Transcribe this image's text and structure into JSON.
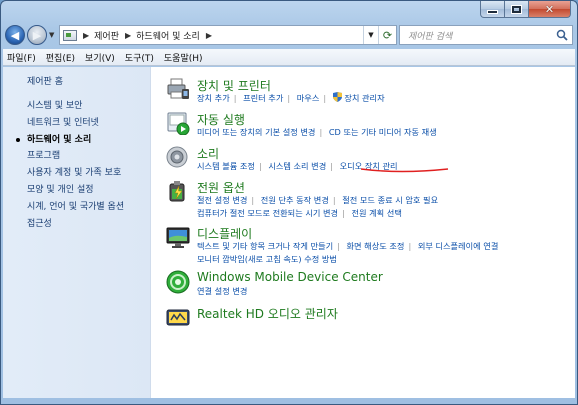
{
  "address": {
    "crumbs": [
      "제어판",
      "하드웨어 및 소리"
    ]
  },
  "search": {
    "placeholder": "제어판 검색"
  },
  "menu": [
    "파일(F)",
    "편집(E)",
    "보기(V)",
    "도구(T)",
    "도움말(H)"
  ],
  "sidebar": {
    "home": "제어판 홈",
    "items": [
      {
        "label": "시스템 및 보안",
        "current": false
      },
      {
        "label": "네트워크 및 인터넷",
        "current": false
      },
      {
        "label": "하드웨어 및 소리",
        "current": true
      },
      {
        "label": "프로그램",
        "current": false
      },
      {
        "label": "사용자 계정 및 가족 보호",
        "current": false
      },
      {
        "label": "모양 및 개인 설정",
        "current": false
      },
      {
        "label": "시계, 언어 및 국가별 옵션",
        "current": false
      },
      {
        "label": "접근성",
        "current": false
      }
    ]
  },
  "categories": [
    {
      "title": "장치 및 프린터",
      "icon": "printer-icon",
      "links": [
        [
          "장치 추가",
          "프린터 추가",
          "마우스",
          "장치 관리자"
        ]
      ]
    },
    {
      "title": "자동 실행",
      "icon": "autoplay-icon",
      "links": [
        [
          "미디어 또는 장치의 기본 설정 변경",
          "CD 또는 기타 미디어 자동 재생"
        ]
      ]
    },
    {
      "title": "소리",
      "icon": "speaker-icon",
      "links": [
        [
          "시스템 볼륨 조정",
          "시스템 소리 변경",
          "오디오 장치 관리"
        ]
      ]
    },
    {
      "title": "전원 옵션",
      "icon": "power-icon",
      "links": [
        [
          "절전 설정 변경",
          "전원 단추 동작 변경",
          "절전 모드 종료 시 암호 필요"
        ],
        [
          "컴퓨터가 절전 모드로 전환되는 시기 변경",
          "전원 계획 선택"
        ]
      ]
    },
    {
      "title": "디스플레이",
      "icon": "display-icon",
      "links": [
        [
          "텍스트 및 기타 항목 크거나 작게 만들기",
          "화면 해상도 조정",
          "외부 디스플레이에 연결"
        ],
        [
          "모니터 깜박임(새로 고침 속도) 수정 방법"
        ]
      ]
    },
    {
      "title": "Windows Mobile Device Center",
      "icon": "sync-icon",
      "links": [
        [
          "연결 설정 변경"
        ]
      ]
    },
    {
      "title": "Realtek HD 오디오 관리자",
      "icon": "realtek-icon",
      "links": []
    }
  ],
  "colors": {
    "category_title": "#1e7a1e",
    "link": "#0a4ea8",
    "annotation": "#e02020"
  }
}
